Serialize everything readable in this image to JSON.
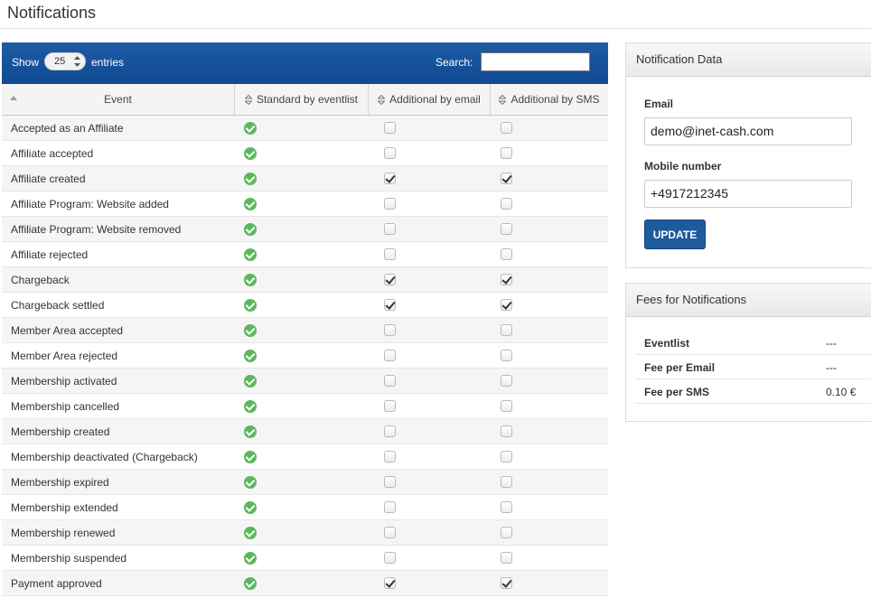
{
  "page": {
    "title": "Notifications"
  },
  "table": {
    "show_label": "Show",
    "entries_value": "25",
    "entries_label": "entries",
    "search_label": "Search:",
    "search_value": "",
    "columns": [
      "Event",
      "Standard by eventlist",
      "Additional by email",
      "Additional by SMS"
    ],
    "rows": [
      {
        "event": "Accepted as an Affiliate",
        "standard": true,
        "email": false,
        "sms": false
      },
      {
        "event": "Affiliate accepted",
        "standard": true,
        "email": false,
        "sms": false
      },
      {
        "event": "Affiliate created",
        "standard": true,
        "email": true,
        "sms": true
      },
      {
        "event": "Affiliate Program: Website added",
        "standard": true,
        "email": false,
        "sms": false
      },
      {
        "event": "Affiliate Program: Website removed",
        "standard": true,
        "email": false,
        "sms": false
      },
      {
        "event": "Affiliate rejected",
        "standard": true,
        "email": false,
        "sms": false
      },
      {
        "event": "Chargeback",
        "standard": true,
        "email": true,
        "sms": true
      },
      {
        "event": "Chargeback settled",
        "standard": true,
        "email": true,
        "sms": true
      },
      {
        "event": "Member Area accepted",
        "standard": true,
        "email": false,
        "sms": false
      },
      {
        "event": "Member Area rejected",
        "standard": true,
        "email": false,
        "sms": false
      },
      {
        "event": "Membership activated",
        "standard": true,
        "email": false,
        "sms": false
      },
      {
        "event": "Membership cancelled",
        "standard": true,
        "email": false,
        "sms": false
      },
      {
        "event": "Membership created",
        "standard": true,
        "email": false,
        "sms": false
      },
      {
        "event": "Membership deactivated (Chargeback)",
        "standard": true,
        "email": false,
        "sms": false
      },
      {
        "event": "Membership expired",
        "standard": true,
        "email": false,
        "sms": false
      },
      {
        "event": "Membership extended",
        "standard": true,
        "email": false,
        "sms": false
      },
      {
        "event": "Membership renewed",
        "standard": true,
        "email": false,
        "sms": false
      },
      {
        "event": "Membership suspended",
        "standard": true,
        "email": false,
        "sms": false
      },
      {
        "event": "Payment approved",
        "standard": true,
        "email": true,
        "sms": true
      }
    ]
  },
  "notification_data": {
    "title": "Notification Data",
    "email_label": "Email",
    "email_value": "demo@inet-cash.com",
    "mobile_label": "Mobile number",
    "mobile_value": "+4917212345",
    "update_label": "UPDATE"
  },
  "fees": {
    "title": "Fees for Notifications",
    "rows": [
      {
        "label": "Eventlist",
        "value": "---"
      },
      {
        "label": "Fee per Email",
        "value": "---"
      },
      {
        "label": "Fee per SMS",
        "value": "0.10 €"
      }
    ]
  },
  "colors": {
    "header_blue": "#1f5aa5",
    "button_blue": "#1e5a9e",
    "ok_green": "#5cb85c"
  },
  "icons": {
    "standard_enabled": "check-circle-icon",
    "sort": "sort-arrows-icon"
  }
}
